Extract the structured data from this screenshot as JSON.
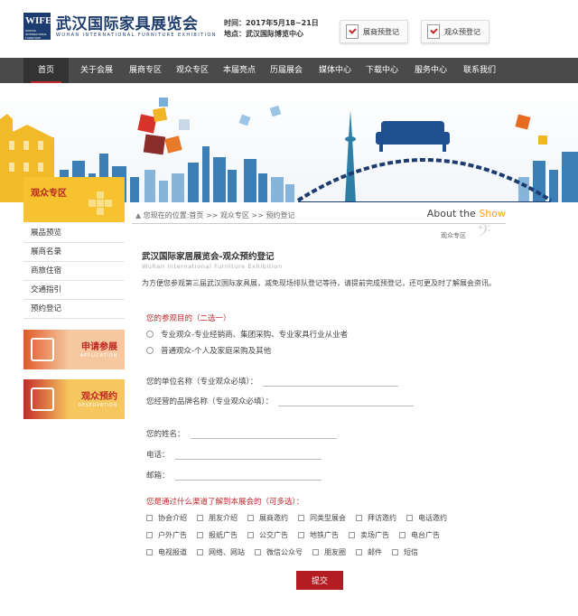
{
  "header": {
    "logo_text": "WIFE",
    "logo_sub": "WUHAN INTERNATIONAL FURNITURE EXPO",
    "title": "武汉国际家具展览会",
    "subtitle": "WUHAN INTERNATIONAL FURNITURE EXHIBITION",
    "time_label": "时间：",
    "time_value": "2017年5月18~21日",
    "venue_label": "地点：",
    "venue_value": "武汉国际博览中心",
    "exhibitor_btn": "展商预登记",
    "visitor_btn": "观众预登记"
  },
  "nav": {
    "items": [
      "首页",
      "关于会展",
      "展商专区",
      "观众专区",
      "本届亮点",
      "历届展会",
      "媒体中心",
      "下载中心",
      "服务中心",
      "联系我们"
    ]
  },
  "sidebar": {
    "title": "观众专区",
    "items": [
      "展品预览",
      "展商名录",
      "商旅住宿",
      "交通指引",
      "预约登记"
    ],
    "promo1_title": "申请参展",
    "promo1_sub": "APPLICATION",
    "promo2_title": "观众预约",
    "promo2_sub": "RESERVATION"
  },
  "content": {
    "breadcrumb": "您现在的位置:首页 >> 观众专区 >> 预约登记",
    "about_prefix": "About the ",
    "about_show": "Show",
    "section_sub": "观众专区",
    "form_title": "武汉国际家居展览会-观众预约登记",
    "form_sub": "Wuhan International Furniture Exhibition",
    "intro": "为方便您参观第三届武汉国际家具展，减免现场排队登记等待，请提前完成预登记，还可更及时了解展会资讯。",
    "purpose_label": "您的参观目的（二选一）",
    "purpose_options": [
      "专业观众-专业经销商、集团采购、专业家具行业从业者",
      "普通观众-个人及家庭采购及其他"
    ],
    "company_label": "您的单位名称（专业观众必填）：",
    "brand_label": "您经营的品牌名称（专业观众必填）：",
    "name_label": "您的姓名：",
    "phone_label": "电话：",
    "email_label": "邮箱：",
    "channel_label": "您是通过什么渠道了解到本展会的（可多选）：",
    "channels_row1": [
      "协会介绍",
      "朋友介绍",
      "展商邀约",
      "同类型展会",
      "拜访邀约",
      "电话邀约"
    ],
    "channels_row2": [
      "户外广告",
      "报纸广告",
      "公交广告",
      "地铁广告",
      "卖场广告",
      "电台广告"
    ],
    "channels_row3": [
      "电视报道",
      "网络、网站",
      "微信公众号",
      "朋友圈",
      "邮件",
      "短信"
    ],
    "submit_label": "提交"
  },
  "colors": {
    "nav_bg": "#4a4a4a",
    "accent_red": "#c0282d",
    "sidebar_yellow": "#f6c230",
    "brand_blue": "#1f3e6c"
  }
}
